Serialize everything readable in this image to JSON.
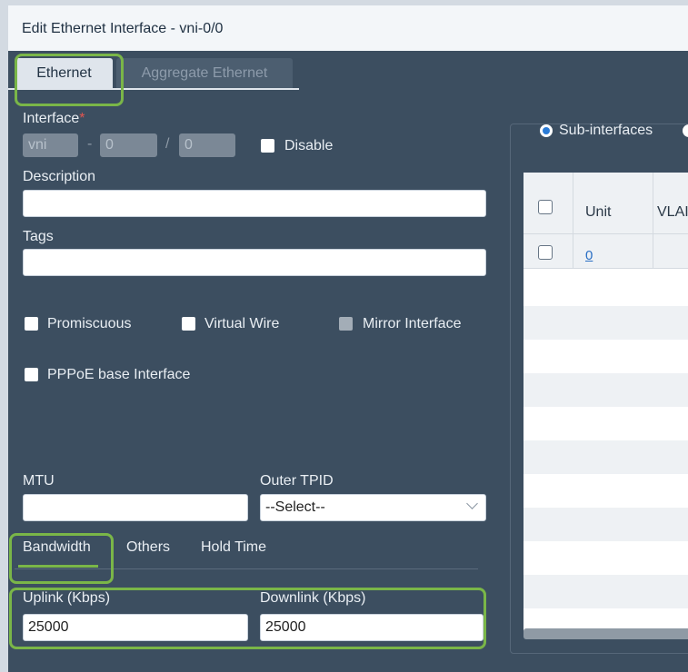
{
  "dialog": {
    "title": "Edit Ethernet Interface - vni-0/0"
  },
  "tabs": [
    {
      "label": "Ethernet",
      "active": true
    },
    {
      "label": "Aggregate Ethernet",
      "active": false
    }
  ],
  "interface": {
    "label": "Interface",
    "required_mark": "*",
    "type_value": "vni",
    "dash": "-",
    "slot_value": "0",
    "slash": "/",
    "port_value": "0",
    "disable_label": "Disable"
  },
  "description": {
    "label": "Description",
    "value": ""
  },
  "tags": {
    "label": "Tags",
    "value": ""
  },
  "options": {
    "promiscuous": "Promiscuous",
    "virtual_wire": "Virtual Wire",
    "mirror_interface": "Mirror Interface",
    "pppoe": "PPPoE base Interface"
  },
  "mtu": {
    "label": "MTU",
    "value": ""
  },
  "outer_tpid": {
    "label": "Outer TPID",
    "selected": "--Select--"
  },
  "subtabs": [
    {
      "label": "Bandwidth",
      "active": true
    },
    {
      "label": "Others",
      "active": false
    },
    {
      "label": "Hold Time",
      "active": false
    }
  ],
  "bandwidth": {
    "uplink_label": "Uplink (Kbps)",
    "uplink_value": "25000",
    "downlink_label": "Downlink (Kbps)",
    "downlink_value": "25000"
  },
  "right_panel": {
    "radio_label": "Sub-interfaces",
    "columns": [
      "Unit",
      "VLAI"
    ],
    "rows": [
      {
        "unit": "0"
      }
    ]
  },
  "colors": {
    "highlight": "#7ab648",
    "dialog_bg": "#3c4e60",
    "accent_radio": "#2a7bd6"
  }
}
